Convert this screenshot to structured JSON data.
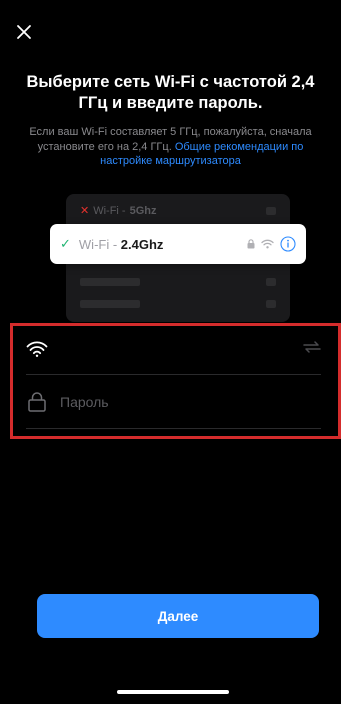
{
  "header": {
    "close_icon": "close-icon"
  },
  "title": "Выберите сеть Wi-Fi с частотой 2,4 ГГц и введите пароль.",
  "subtitle": {
    "text": "Если ваш Wi-Fi составляет 5 ГГц, пожалуйста, сначала установите его на 2,4 ГГц.",
    "link": "Общие рекомендации по настройке маршрутизатора"
  },
  "illustration": {
    "network_5g": {
      "prefix": "Wi-Fi - ",
      "band": "5Ghz",
      "status_icon": "x-icon"
    },
    "network_24g": {
      "prefix": "Wi-Fi - ",
      "band": "2.4Ghz",
      "status_icon": "check-icon"
    }
  },
  "form": {
    "wifi_name": "",
    "password_placeholder": "Пароль",
    "password_value": ""
  },
  "next_button": "Далее",
  "colors": {
    "accent": "#2e8bff",
    "highlight_border": "#d42c2c",
    "success": "#22b573",
    "error": "#e5322d"
  }
}
